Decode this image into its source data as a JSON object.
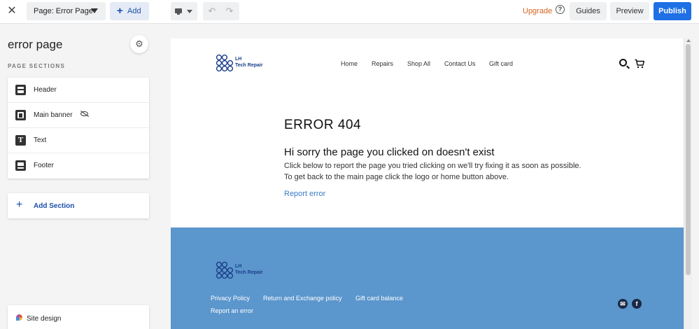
{
  "toolbar": {
    "close_icon": "close-icon",
    "page_selector": "Page: Error Page",
    "add_label": "Add",
    "upgrade_label": "Upgrade",
    "help_label": "?",
    "guides_label": "Guides",
    "preview_label": "Preview",
    "publish_label": "Publish"
  },
  "sidebar": {
    "title": "error page",
    "caption": "PAGE SECTIONS",
    "sections": [
      {
        "label": "Header",
        "icon": "header-section-icon"
      },
      {
        "label": "Main banner",
        "icon": "banner-section-icon",
        "hidden": true
      },
      {
        "label": "Text",
        "icon": "text-section-icon"
      },
      {
        "label": "Footer",
        "icon": "footer-section-icon"
      }
    ],
    "add_section_label": "Add Section",
    "site_design_label": "Site design"
  },
  "site": {
    "logo_line1": "LH",
    "logo_line2": "Tech Repair",
    "nav": [
      "Home",
      "Repairs",
      "Shop All",
      "Contact Us",
      "Gift card"
    ],
    "error_title": "ERROR 404",
    "heading": "Hi sorry the page you clicked on doesn't exist",
    "line1": "Click below to report the page you tried clicking on we'll try fixing it as soon as possible.",
    "line2": "To get back to the main page click the logo or home button above.",
    "report_link": "Report error",
    "footer": {
      "logo_line1": "LH",
      "logo_line2": "Tech Repair",
      "links": [
        "Privacy Policy",
        "Return and Exchange policy",
        "Gift card balance",
        "Report an error"
      ],
      "social": [
        "email-icon",
        "facebook-icon"
      ]
    }
  },
  "colors": {
    "accent": "#1f6fe5",
    "upgrade": "#d8631b",
    "footer_bg": "#5b96cc",
    "link": "#3a7bc8"
  }
}
